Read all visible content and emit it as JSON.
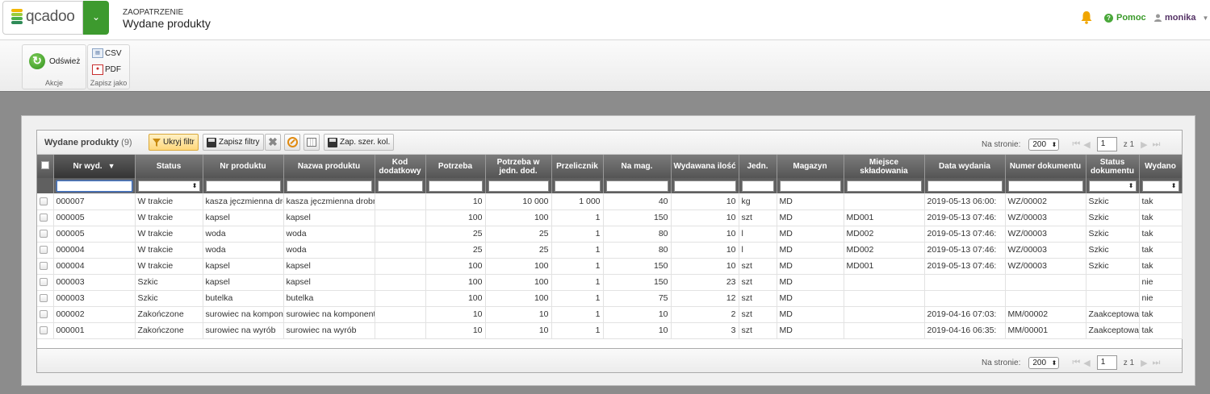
{
  "app": {
    "logo_text": "qcadoo"
  },
  "header": {
    "section": "ZAOPATRZENIE",
    "title": "Wydane produkty",
    "help_label": "Pomoc",
    "user_name": "monika"
  },
  "ribbon": {
    "actions": {
      "refresh_label": "Odśwież",
      "group_label": "Akcje"
    },
    "save_as": {
      "csv_label": "CSV",
      "pdf_label": "PDF",
      "group_label": "Zapisz jako"
    }
  },
  "grid": {
    "title": "Wydane produkty",
    "count": "(9)",
    "toolbar": {
      "hide_filter": "Ukryj filtr",
      "save_filters": "Zapisz filtry",
      "save_col_width": "Zap. szer. kol."
    },
    "pager": {
      "per_page_label": "Na stronie:",
      "per_page_value": "200",
      "page": "1",
      "of_label": "z 1"
    },
    "columns": [
      "Nr wyd.",
      "Status",
      "Nr produktu",
      "Nazwa produktu",
      "Kod dodatkowy",
      "Potrzeba",
      "Potrzeba w jedn. dod.",
      "Przelicznik",
      "Na mag.",
      "Wydawana ilość",
      "Jedn.",
      "Magazyn",
      "Miejsce składowania",
      "Data wydania",
      "Numer dokumentu",
      "Status dokumentu",
      "Wydano"
    ],
    "rows": [
      [
        "000007",
        "W trakcie",
        "kasza jęczmienna drobna",
        "kasza jęczmienna drobna",
        "",
        "10",
        "10 000",
        "1 000",
        "40",
        "10",
        "kg",
        "MD",
        "",
        "2019-05-13 06:00:",
        "WZ/00002",
        "Szkic",
        "tak"
      ],
      [
        "000005",
        "W trakcie",
        "kapsel",
        "kapsel",
        "",
        "100",
        "100",
        "1",
        "150",
        "10",
        "szt",
        "MD",
        "MD001",
        "2019-05-13 07:46:",
        "WZ/00003",
        "Szkic",
        "tak"
      ],
      [
        "000005",
        "W trakcie",
        "woda",
        "woda",
        "",
        "25",
        "25",
        "1",
        "80",
        "10",
        "l",
        "MD",
        "MD002",
        "2019-05-13 07:46:",
        "WZ/00003",
        "Szkic",
        "tak"
      ],
      [
        "000004",
        "W trakcie",
        "woda",
        "woda",
        "",
        "25",
        "25",
        "1",
        "80",
        "10",
        "l",
        "MD",
        "MD002",
        "2019-05-13 07:46:",
        "WZ/00003",
        "Szkic",
        "tak"
      ],
      [
        "000004",
        "W trakcie",
        "kapsel",
        "kapsel",
        "",
        "100",
        "100",
        "1",
        "150",
        "10",
        "szt",
        "MD",
        "MD001",
        "2019-05-13 07:46:",
        "WZ/00003",
        "Szkic",
        "tak"
      ],
      [
        "000003",
        "Szkic",
        "kapsel",
        "kapsel",
        "",
        "100",
        "100",
        "1",
        "150",
        "23",
        "szt",
        "MD",
        "",
        "",
        "",
        "",
        "nie"
      ],
      [
        "000003",
        "Szkic",
        "butelka",
        "butelka",
        "",
        "100",
        "100",
        "1",
        "75",
        "12",
        "szt",
        "MD",
        "",
        "",
        "",
        "",
        "nie"
      ],
      [
        "000002",
        "Zakończone",
        "surowiec na komponent",
        "surowiec na komponent",
        "",
        "10",
        "10",
        "1",
        "10",
        "2",
        "szt",
        "MD",
        "",
        "2019-04-16 07:03:",
        "MM/00002",
        "Zaakceptowany",
        "tak"
      ],
      [
        "000001",
        "Zakończone",
        "surowiec na wyrób",
        "surowiec na wyrób",
        "",
        "10",
        "10",
        "1",
        "10",
        "3",
        "szt",
        "MD",
        "",
        "2019-04-16 06:35:",
        "MM/00001",
        "Zaakceptowany",
        "tak"
      ]
    ]
  },
  "colors": {
    "accent_green": "#3d9a2e",
    "header_dark": "#555555",
    "bell": "#f0a500"
  }
}
